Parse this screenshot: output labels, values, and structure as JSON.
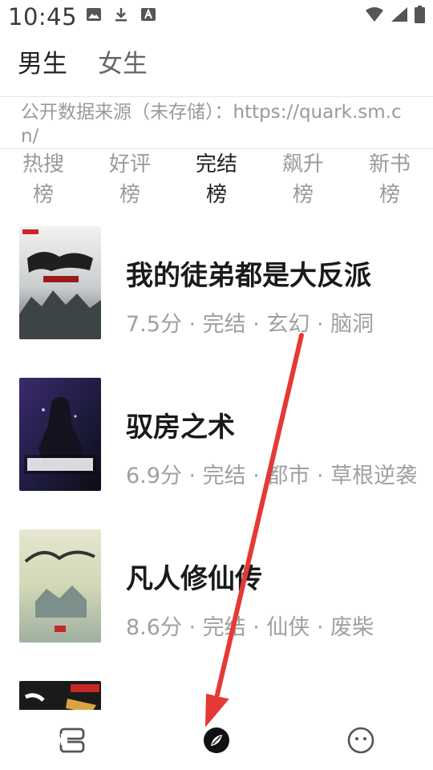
{
  "status_bar": {
    "time": "10:45",
    "left_icons": [
      "image-icon",
      "download-icon",
      "font-icon"
    ],
    "right_icons": [
      "wifi-icon",
      "signal-icon",
      "battery-icon"
    ]
  },
  "gender_tabs": [
    {
      "label": "男生",
      "active": true
    },
    {
      "label": "女生",
      "active": false
    }
  ],
  "notice": {
    "text": "公开数据来源（未存储）：https://quark.sm.cn/"
  },
  "rank_tabs": [
    {
      "label": "热搜榜",
      "active": false
    },
    {
      "label": "好评榜",
      "active": false
    },
    {
      "label": "完结榜",
      "active": true
    },
    {
      "label": "飙升榜",
      "active": false
    },
    {
      "label": "新书榜",
      "active": false
    }
  ],
  "books": [
    {
      "title": "我的徒弟都是大反派",
      "meta": "7.5分 · 完结 · 玄幻 · 脑洞"
    },
    {
      "title": "驭房之术",
      "meta": "6.9分 · 完结 · 都市 · 草根逆袭"
    },
    {
      "title": "凡人修仙传",
      "meta": "8.6分 · 完结 · 仙侠 · 废柴"
    }
  ],
  "bottom_nav": [
    {
      "name": "bookshelf-icon",
      "active": false
    },
    {
      "name": "compass-icon",
      "active": true
    },
    {
      "name": "smiley-profile-icon",
      "active": false
    }
  ],
  "colors": {
    "annotation_arrow": "#e53935",
    "active_text": "#222222",
    "inactive_text": "#9a9a9a"
  }
}
